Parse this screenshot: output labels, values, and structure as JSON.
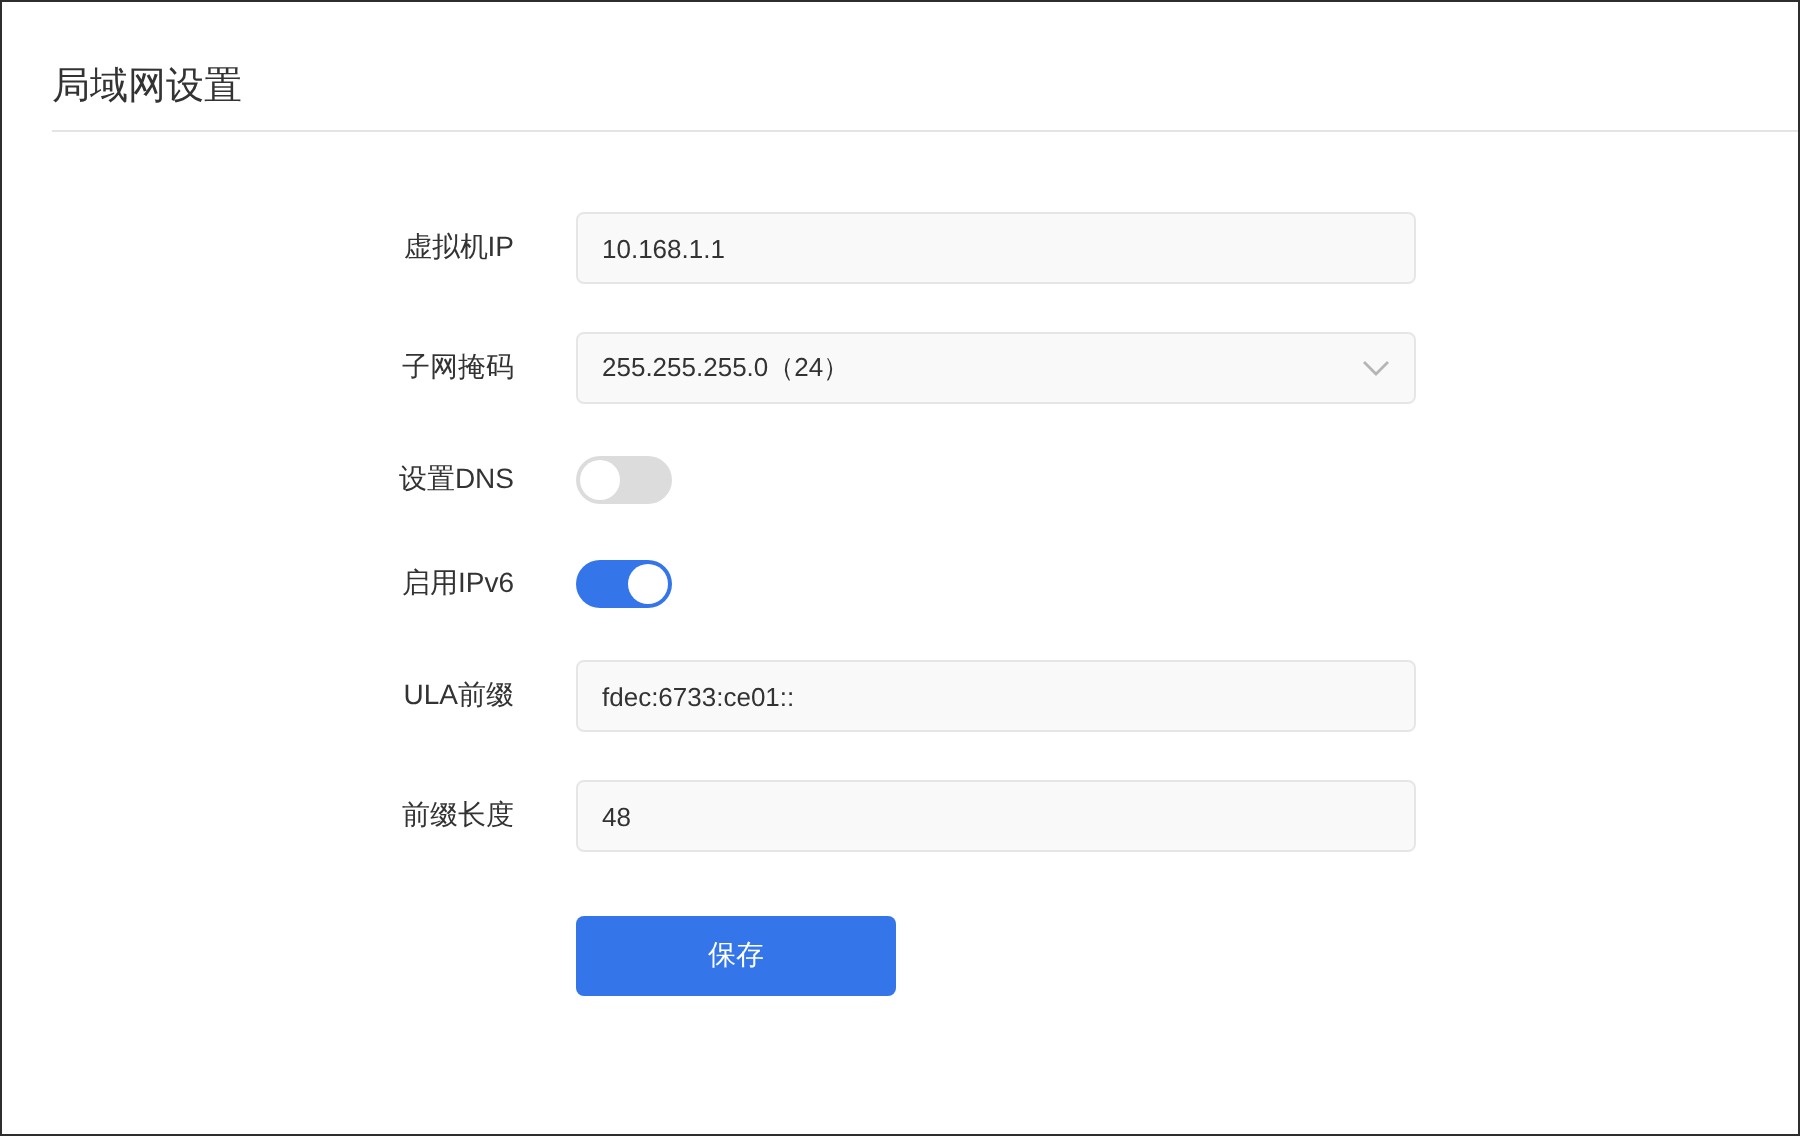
{
  "title": "局域网设置",
  "fields": [
    {
      "kind": "input",
      "label": "虚拟机IP",
      "value": "10.168.1.1"
    },
    {
      "kind": "select",
      "label": "子网掩码",
      "value": "255.255.255.0（24）"
    },
    {
      "kind": "switch",
      "label": "设置DNS",
      "on": false
    },
    {
      "kind": "switch",
      "label": "启用IPv6",
      "on": true
    },
    {
      "kind": "input",
      "label": "ULA前缀",
      "value": "fdec:6733:ce01::"
    },
    {
      "kind": "input",
      "label": "前缀长度",
      "value": "48"
    }
  ],
  "save_button": "保存"
}
